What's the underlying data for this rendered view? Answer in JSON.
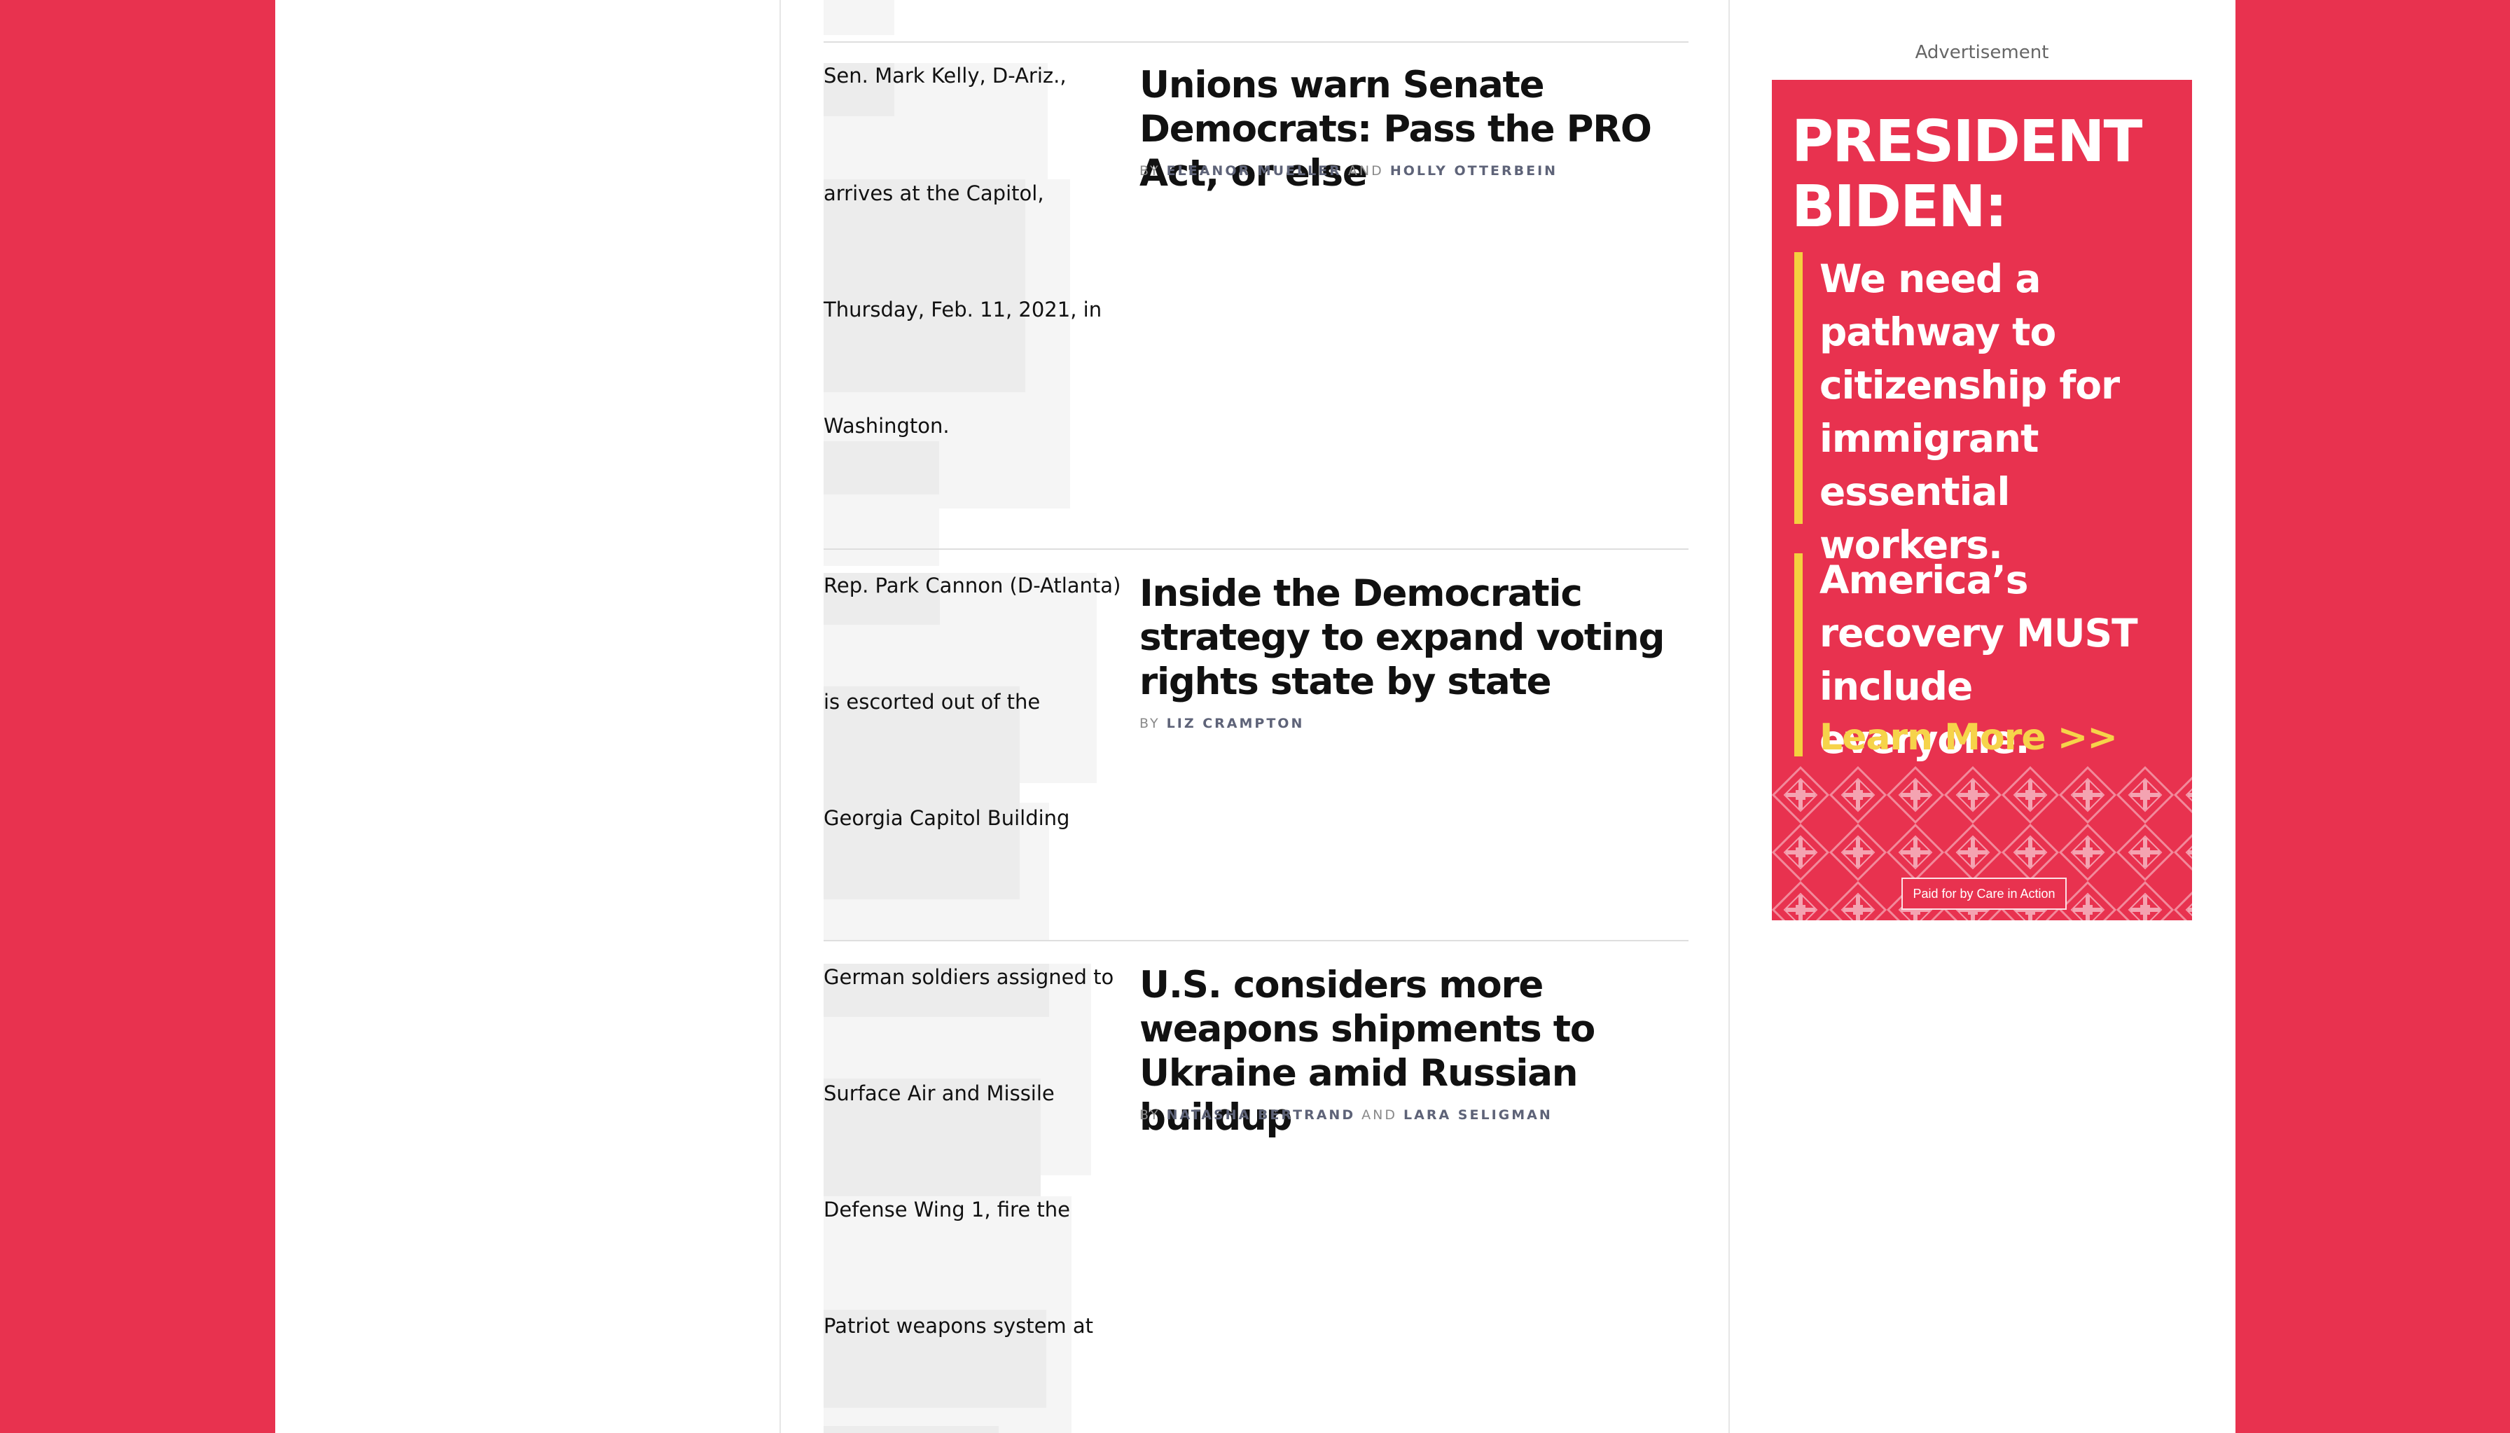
{
  "articles": [
    {
      "caption_lines": [
        "Sen. Mark Kelly, D-Ariz.,",
        "arrives at the Capitol,",
        "Thursday, Feb. 11, 2021, in",
        "Washington."
      ],
      "headline": "Unions warn Senate Democrats: Pass the PRO Act, or else",
      "byline": {
        "prefix": "BY",
        "authors": [
          "ELEANOR MUELLER",
          "HOLLY OTTERBEIN"
        ],
        "joiner": "AND"
      }
    },
    {
      "caption_lines": [
        "Rep. Park Cannon (D-Atlanta)",
        "is escorted out of the",
        "Georgia Capitol Building"
      ],
      "headline": "Inside the Democratic strategy to expand voting rights state by state",
      "byline": {
        "prefix": "BY",
        "authors": [
          "LIZ CRAMPTON"
        ],
        "joiner": ""
      }
    },
    {
      "caption_lines": [
        "German soldiers assigned to",
        "Surface Air and Missile",
        "Defense Wing 1, fire the",
        "Patriot weapons system at"
      ],
      "headline": "U.S. considers more weapons shipments to Ukraine amid Russian buildup",
      "byline": {
        "prefix": "BY",
        "authors": [
          "NATASHA BERTRAND",
          "LARA SELIGMAN"
        ],
        "joiner": "AND"
      }
    }
  ],
  "ad": {
    "label": "Advertisement",
    "title": "PRESIDENT BIDEN:",
    "paragraph_1": "We need a pathway to citizenship for immigrant essential workers.",
    "paragraph_2": "America’s recovery MUST include everyone.",
    "cta": "Learn More >>",
    "paid_for": "Paid for by Care in Action",
    "colors": {
      "background": "#e8324f",
      "accent": "#f4d03f"
    }
  },
  "colors": {
    "page_background": "#e8324f",
    "content_background": "#ffffff"
  }
}
